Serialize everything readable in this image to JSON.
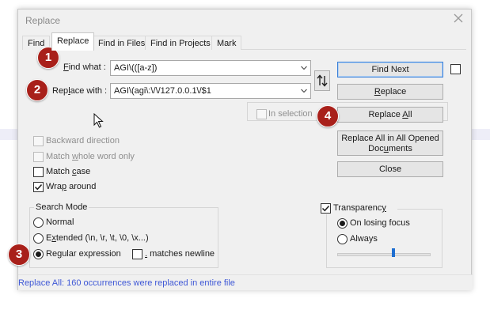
{
  "dialog": {
    "title": "Replace",
    "close_icon": "close-icon"
  },
  "tabs": [
    {
      "label": "Find",
      "active": false
    },
    {
      "label": "Replace",
      "active": true
    },
    {
      "label": "Find in Files",
      "active": false
    },
    {
      "label": "Find in Projects",
      "active": false
    },
    {
      "label": "Mark",
      "active": false
    }
  ],
  "find_what": {
    "label_prefix": "F",
    "label_rest": "ind what :",
    "value": "AGI\\(([a-z])"
  },
  "replace_with": {
    "label_prefix": "Rep",
    "label_u": "l",
    "label_rest": "ace with :",
    "value": "AGI\\(agi\\:\\/\\/127.0.0.1\\/$1"
  },
  "swap_icon": "swap-vertical-icon",
  "in_selection": {
    "label": "In selection",
    "checked": false,
    "enabled": false
  },
  "options": {
    "backward": {
      "label": "Backward direction",
      "checked": false,
      "enabled": false
    },
    "whole_word_a": "Match ",
    "whole_word_u": "w",
    "whole_word_b": "hole word only",
    "match_case_a": "Match ",
    "match_case_u": "c",
    "match_case_b": "ase",
    "match_case_checked": false,
    "wrap_a": "Wra",
    "wrap_u": "p",
    "wrap_b": " around",
    "wrap_checked": true
  },
  "search_mode": {
    "title": "Search Mode",
    "normal": {
      "label": "Normal",
      "selected": false
    },
    "extended_a": "E",
    "extended_u": "x",
    "extended_b": "tended (\\n, \\r, \\t, \\0, \\x...)",
    "extended_selected": false,
    "regex_a": "Re",
    "regex_u": "g",
    "regex_b": "ular expression",
    "regex_selected": true,
    "newline_u": ".",
    "newline_b": " matches newline",
    "newline_checked": false
  },
  "buttons": {
    "find_next": "Find Next",
    "replace_a": "",
    "replace_u": "R",
    "replace_b": "eplace",
    "replace_all_a": "Replace ",
    "replace_all_u": "A",
    "replace_all_b": "ll",
    "replace_all_opened_1": "Replace All in All Opened",
    "replace_all_opened_2a": "Doc",
    "replace_all_opened_2u": "u",
    "replace_all_opened_2b": "ments",
    "close": "Close"
  },
  "transparency": {
    "label_a": "Transparenc",
    "label_u": "y",
    "checked": true,
    "on_losing_focus": {
      "label": "On losing focus",
      "selected": true
    },
    "always": {
      "label": "Always",
      "selected": false
    },
    "slider_value_percent": 60
  },
  "status": {
    "text": "Replace All: 160 occurrences were replaced in entire file",
    "color": "#3f58d6"
  },
  "badges": [
    "1",
    "2",
    "3",
    "4"
  ],
  "badge_color": "#a8201a",
  "cursor_icon": "mouse-pointer-icon"
}
